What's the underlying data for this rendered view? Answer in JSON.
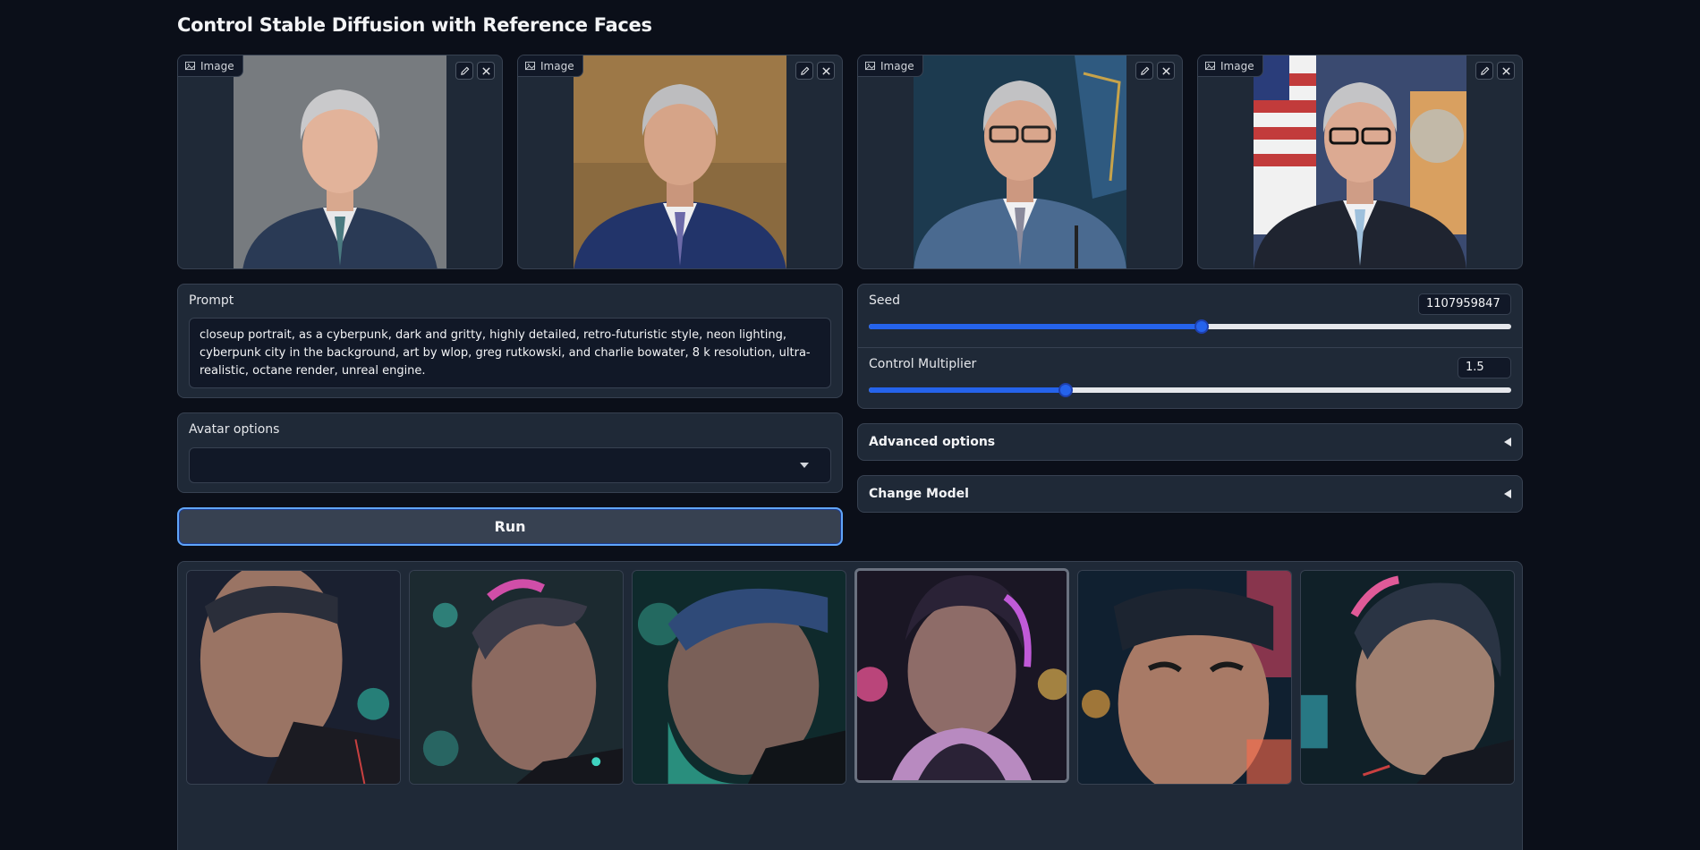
{
  "page": {
    "title": "Control Stable Diffusion with Reference Faces"
  },
  "reference_images": [
    {
      "label": "Image",
      "background": "#6b6f73"
    },
    {
      "label": "Image",
      "background": "#8a6a3f"
    },
    {
      "label": "Image",
      "background": "#1c3a4f"
    },
    {
      "label": "Image",
      "background": "#3a4a70"
    }
  ],
  "icons": {
    "image": "image-icon",
    "edit": "pencil-icon",
    "clear": "close-icon",
    "dropdown": "chevron-down-icon",
    "collapse": "triangle-left-icon"
  },
  "prompt": {
    "label": "Prompt",
    "value": "closeup portrait, as a cyberpunk, dark and gritty, highly detailed, retro-futuristic style, neon lighting, cyberpunk city in the background, art by wlop, greg rutkowski, and charlie bowater, 8 k resolution, ultra-realistic, octane render, unreal engine."
  },
  "avatar_options": {
    "label": "Avatar options",
    "value": ""
  },
  "run_button": {
    "label": "Run"
  },
  "seed": {
    "label": "Seed",
    "value": "1107959847",
    "fraction": 0.518
  },
  "control_multiplier": {
    "label": "Control Multiplier",
    "value": "1.5",
    "fraction": 0.306
  },
  "accordions": [
    {
      "label": "Advanced options"
    },
    {
      "label": "Change Model"
    }
  ],
  "gallery": {
    "count": 6,
    "selected_index": 3
  },
  "colors": {
    "accent": "#2563eb",
    "panel": "#1f2937",
    "background": "#0b0f19"
  }
}
